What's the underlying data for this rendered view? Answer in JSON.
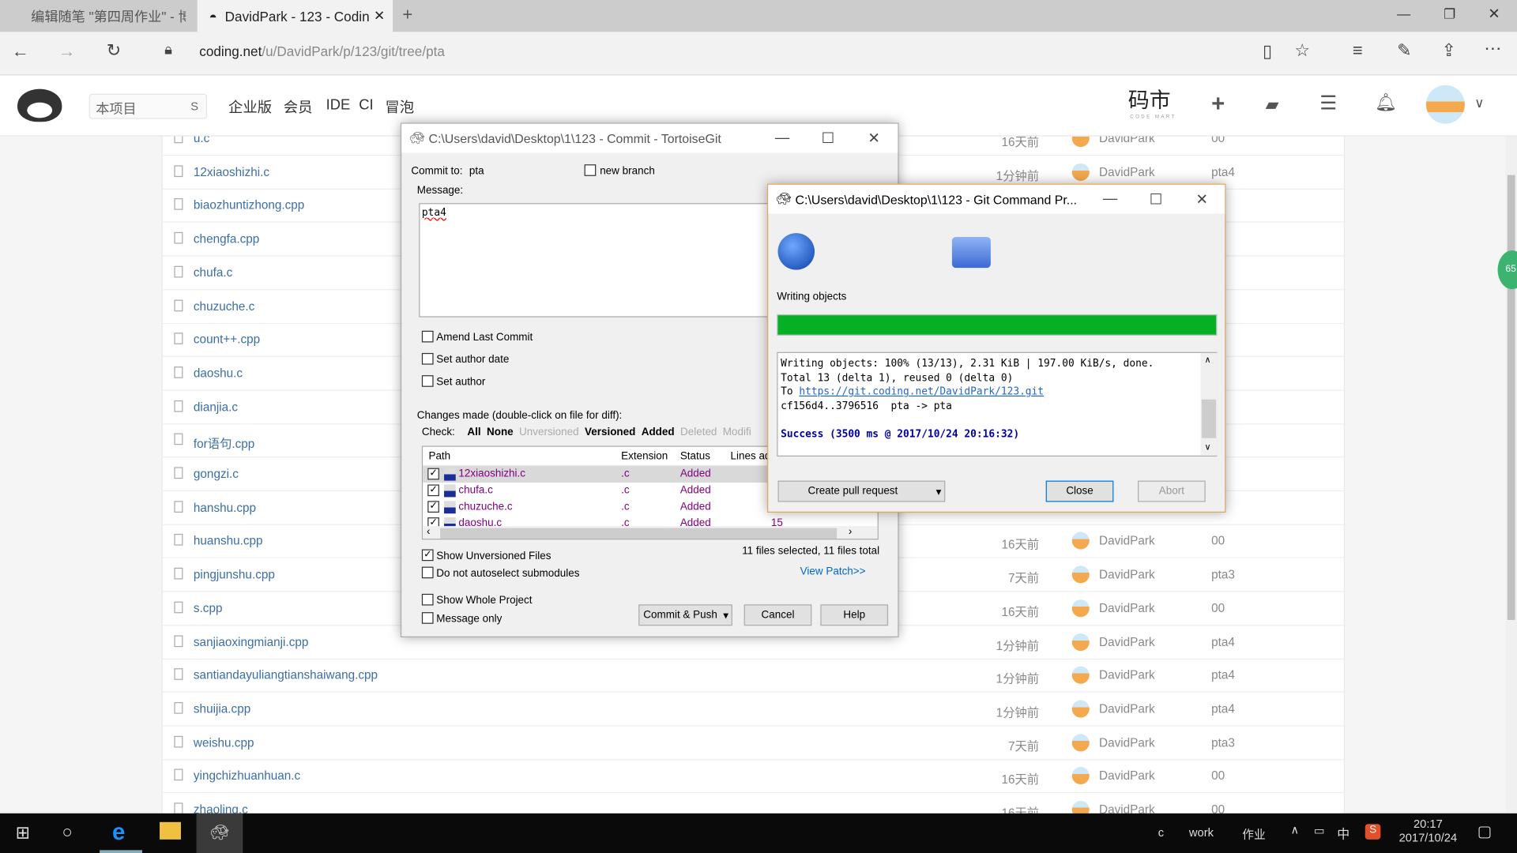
{
  "browser": {
    "tabs": [
      {
        "label": "编辑随笔 \"第四周作业\" - 博客",
        "active": false
      },
      {
        "label": "DavidPark - 123 - Codin",
        "active": true
      }
    ],
    "url_host": "coding.net",
    "url_path": "/u/DavidPark/p/123/git/tree/pta"
  },
  "site": {
    "search_placeholder": "本项目",
    "search_shortcut": "S",
    "nav": [
      "企业版",
      "会员",
      "IDE",
      "CI",
      "冒泡"
    ],
    "codemart": "码市",
    "codemart_sub": "CODE MART"
  },
  "files": [
    {
      "name": "u.c",
      "time": "16天前",
      "author": "DavidPark",
      "msg": "00"
    },
    {
      "name": "12xiaoshizhi.c",
      "time": "1分钟前",
      "author": "DavidPark",
      "msg": "pta4"
    },
    {
      "name": "biaozhuntizhong.cpp",
      "time": "",
      "author": "",
      "msg": ""
    },
    {
      "name": "chengfa.cpp",
      "time": "",
      "author": "",
      "msg": ""
    },
    {
      "name": "chufa.c",
      "time": "",
      "author": "",
      "msg": ""
    },
    {
      "name": "chuzuche.c",
      "time": "",
      "author": "",
      "msg": ""
    },
    {
      "name": "count++.cpp",
      "time": "",
      "author": "",
      "msg": ""
    },
    {
      "name": "daoshu.c",
      "time": "",
      "author": "",
      "msg": ""
    },
    {
      "name": "dianjia.c",
      "time": "",
      "author": "",
      "msg": ""
    },
    {
      "name": "for语句.cpp",
      "time": "",
      "author": "",
      "msg": ""
    },
    {
      "name": "gongzi.c",
      "time": "",
      "author": "",
      "msg": ""
    },
    {
      "name": "hanshu.cpp",
      "time": "",
      "author": "",
      "msg": ""
    },
    {
      "name": "huanshu.cpp",
      "time": "16天前",
      "author": "DavidPark",
      "msg": "00"
    },
    {
      "name": "pingjunshu.cpp",
      "time": "7天前",
      "author": "DavidPark",
      "msg": "pta3"
    },
    {
      "name": "s.cpp",
      "time": "16天前",
      "author": "DavidPark",
      "msg": "00"
    },
    {
      "name": "sanjiaoxingmianji.cpp",
      "time": "1分钟前",
      "author": "DavidPark",
      "msg": "pta4"
    },
    {
      "name": "santiandayuliangtianshaiwang.cpp",
      "time": "1分钟前",
      "author": "DavidPark",
      "msg": "pta4"
    },
    {
      "name": "shuijia.cpp",
      "time": "1分钟前",
      "author": "DavidPark",
      "msg": "pta4"
    },
    {
      "name": "weishu.cpp",
      "time": "7天前",
      "author": "DavidPark",
      "msg": "pta3"
    },
    {
      "name": "yingchizhuanhuan.c",
      "time": "16天前",
      "author": "DavidPark",
      "msg": "00"
    },
    {
      "name": "zhaoling.c",
      "time": "16天前",
      "author": "DavidPark",
      "msg": "00"
    }
  ],
  "commit": {
    "title": "C:\\Users\\david\\Desktop\\1\\123 - Commit - TortoiseGit",
    "commit_to_label": "Commit to:",
    "branch": "pta",
    "new_branch": "new branch",
    "message_label": "Message:",
    "message": "pta4",
    "amend": "Amend Last Commit",
    "author_date": "Set author date",
    "set_author": "Set author",
    "changes_label": "Changes made (double-click on file for diff):",
    "check_label": "Check:",
    "filters": [
      {
        "t": "All",
        "on": true
      },
      {
        "t": "None",
        "on": true
      },
      {
        "t": "Unversioned",
        "on": false
      },
      {
        "t": "Versioned",
        "on": true
      },
      {
        "t": "Added",
        "on": true
      },
      {
        "t": "Deleted",
        "on": false
      },
      {
        "t": "Modifi",
        "on": false
      }
    ],
    "columns": [
      "Path",
      "Extension",
      "Status",
      "Lines ad"
    ],
    "rows": [
      {
        "path": "12xiaoshizhi.c",
        "ext": ".c",
        "status": "Added",
        "lines": ""
      },
      {
        "path": "chufa.c",
        "ext": ".c",
        "status": "Added",
        "lines": ""
      },
      {
        "path": "chuzuche.c",
        "ext": ".c",
        "status": "Added",
        "lines": ""
      },
      {
        "path": "daoshu.c",
        "ext": ".c",
        "status": "Added",
        "lines": "15"
      }
    ],
    "show_unversioned": "Show Unversioned Files",
    "no_autoselect": "Do not autoselect submodules",
    "selected_info": "11 files selected, 11 files total",
    "view_patch": "View Patch>>",
    "whole_project": "Show Whole Project",
    "message_only": "Message only",
    "commit_push": "Commit & Push",
    "cancel": "Cancel",
    "help": "Help"
  },
  "progress": {
    "title": "C:\\Users\\david\\Desktop\\1\\123 - Git Command Pr...",
    "status": "Writing objects",
    "percent": 100,
    "bar_color": "#06b025",
    "log": [
      "Writing objects: 100% (13/13), 2.31 KiB | 197.00 KiB/s, done.",
      "Total 13 (delta 1), reused 0 (delta 0)"
    ],
    "to_prefix": "To ",
    "to_url": "https://git.coding.net/DavidPark/123.git",
    "refs": "cf156d4..3796516  pta -> pta",
    "success": "Success (3500 ms @ 2017/10/24 20:16:32)",
    "create_pr": "Create pull request",
    "close": "Close",
    "abort": "Abort"
  },
  "taskbar": {
    "tray": [
      "c",
      "work",
      "作业"
    ],
    "ime": "中",
    "time": "20:17",
    "date": "2017/10/24"
  }
}
